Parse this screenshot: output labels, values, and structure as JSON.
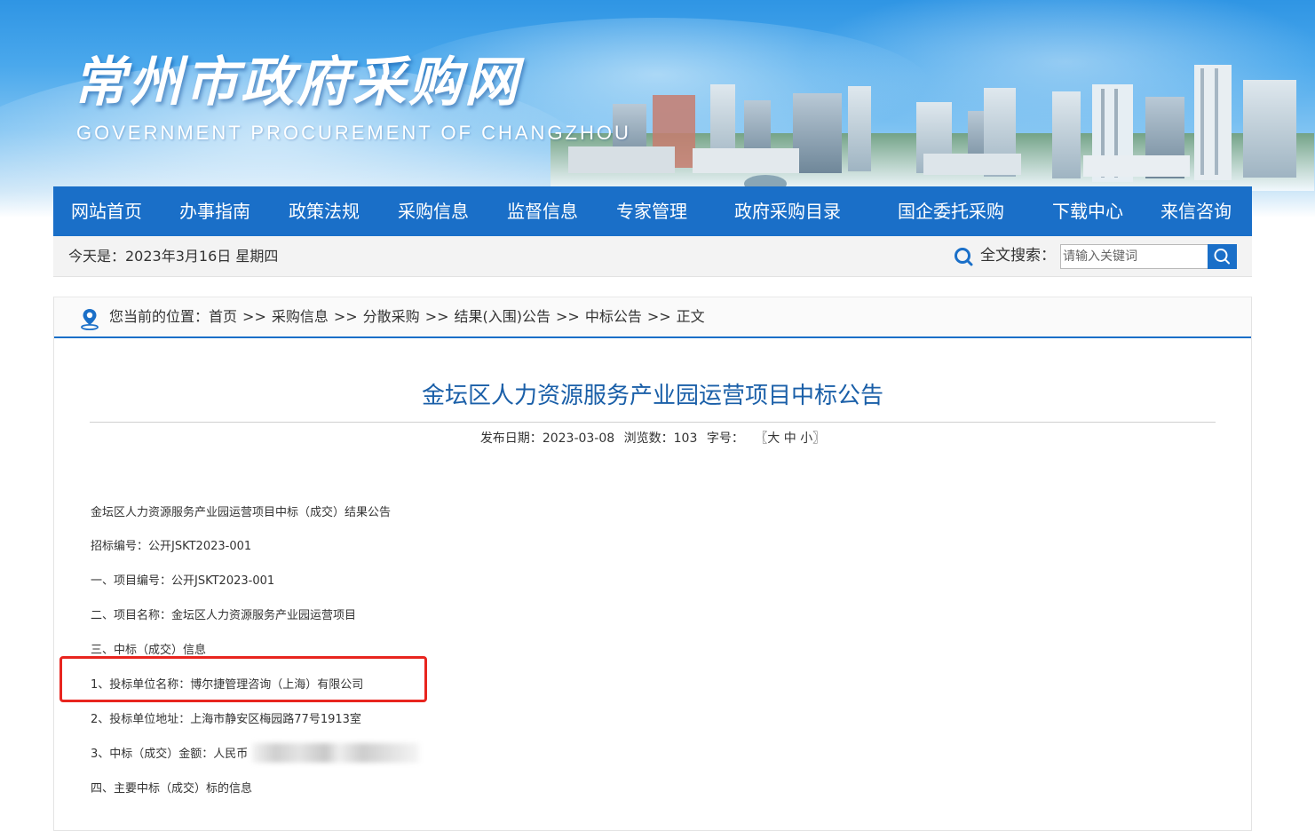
{
  "header": {
    "site_title": "常州市政府采购网",
    "site_subtitle": "GOVERNMENT PROCUREMENT OF CHANGZHOU"
  },
  "nav": {
    "items": [
      "网站首页",
      "办事指南",
      "政策法规",
      "采购信息",
      "监督信息",
      "专家管理",
      "政府采购目录",
      "国企委托采购",
      "下载中心",
      "来信咨询"
    ]
  },
  "infobar": {
    "today": "今天是：2023年3月16日 星期四",
    "search_label": "全文搜索：",
    "search_placeholder": "请输入关键词"
  },
  "breadcrumb": {
    "prefix": "您当前的位置：",
    "items": [
      "首页",
      "采购信息",
      "分散采购",
      "结果(入围)公告",
      "中标公告",
      "正文"
    ],
    "separator": ">>"
  },
  "article": {
    "title": "金坛区人力资源服务产业园运营项目中标公告",
    "publish_label": "发布日期：",
    "publish_date": "2023-03-08",
    "views_label": "浏览数：",
    "views": "103",
    "font_size_label": "字号：",
    "font_size_open": "〖",
    "font_size_large": "大",
    "font_size_medium": "中",
    "font_size_small": "小",
    "font_size_close": "〗",
    "paragraphs": [
      "金坛区人力资源服务产业园运营项目中标（成交）结果公告",
      "招标编号：公开JSKT2023-001",
      "一、项目编号：公开JSKT2023-001",
      "二、项目名称：金坛区人力资源服务产业园运营项目",
      "三、中标（成交）信息",
      "1、投标单位名称：博尔捷管理咨询（上海）有限公司",
      "2、投标单位地址：上海市静安区梅园路77号1913室",
      "3、中标（成交）金额：人民币",
      "四、主要中标（成交）标的信息"
    ]
  },
  "colors": {
    "nav_bg": "#1a6fc8",
    "title_color": "#1a5fa8",
    "highlight_border": "#e8251f"
  }
}
